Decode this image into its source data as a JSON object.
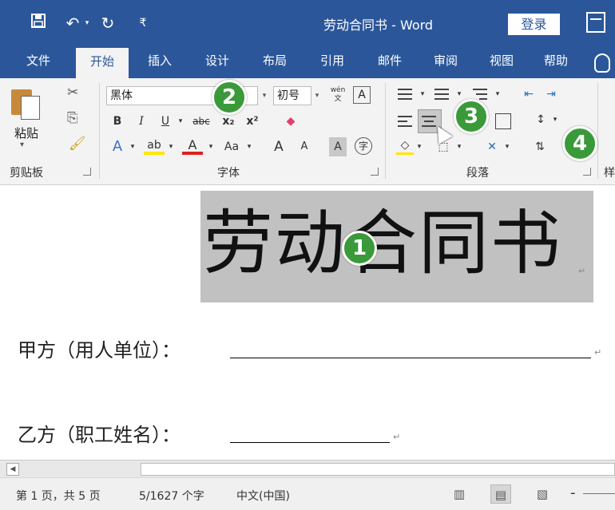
{
  "titlebar": {
    "save_icon": "💾",
    "undo_icon": "↶",
    "redo_icon": "↻",
    "qat_icon": "⏷",
    "doc_title": "劳动合同书 - Word",
    "login": "登录"
  },
  "tabs": [
    "文件",
    "开始",
    "插入",
    "设计",
    "布局",
    "引用",
    "邮件",
    "审阅",
    "视图",
    "帮助"
  ],
  "ribbon": {
    "clipboard": {
      "paste": "粘贴",
      "label": "剪贴板"
    },
    "font": {
      "name": "黑体",
      "size": "初号",
      "ruby": "wén\n文",
      "charbox": "A",
      "bold": "B",
      "italic": "I",
      "underline": "U",
      "strike": "abc",
      "subscript": "x₂",
      "superscript": "x²",
      "text_effects": "A",
      "highlight": "ab",
      "font_color": "A",
      "change_case": "Aa",
      "grow": "A",
      "shrink": "A",
      "shade": "A",
      "enclose": "字",
      "label": "字体"
    },
    "paragraph": {
      "label": "段落"
    },
    "styles_partial": "样"
  },
  "badges": [
    "1",
    "2",
    "3",
    "4"
  ],
  "document": {
    "heading": "劳动合同书",
    "party_a": "甲方（用人单位）：",
    "party_b": "乙方（职工姓名）：",
    "para_mark": "↵"
  },
  "statusbar": {
    "page": "第 1 页，共 5 页",
    "words": "5/1627 个字",
    "language": "中文(中国)"
  },
  "colors": {
    "word_blue": "#2b579a",
    "badge_green": "#3a9a3a",
    "heading_highlight": "#c1c1c1"
  }
}
